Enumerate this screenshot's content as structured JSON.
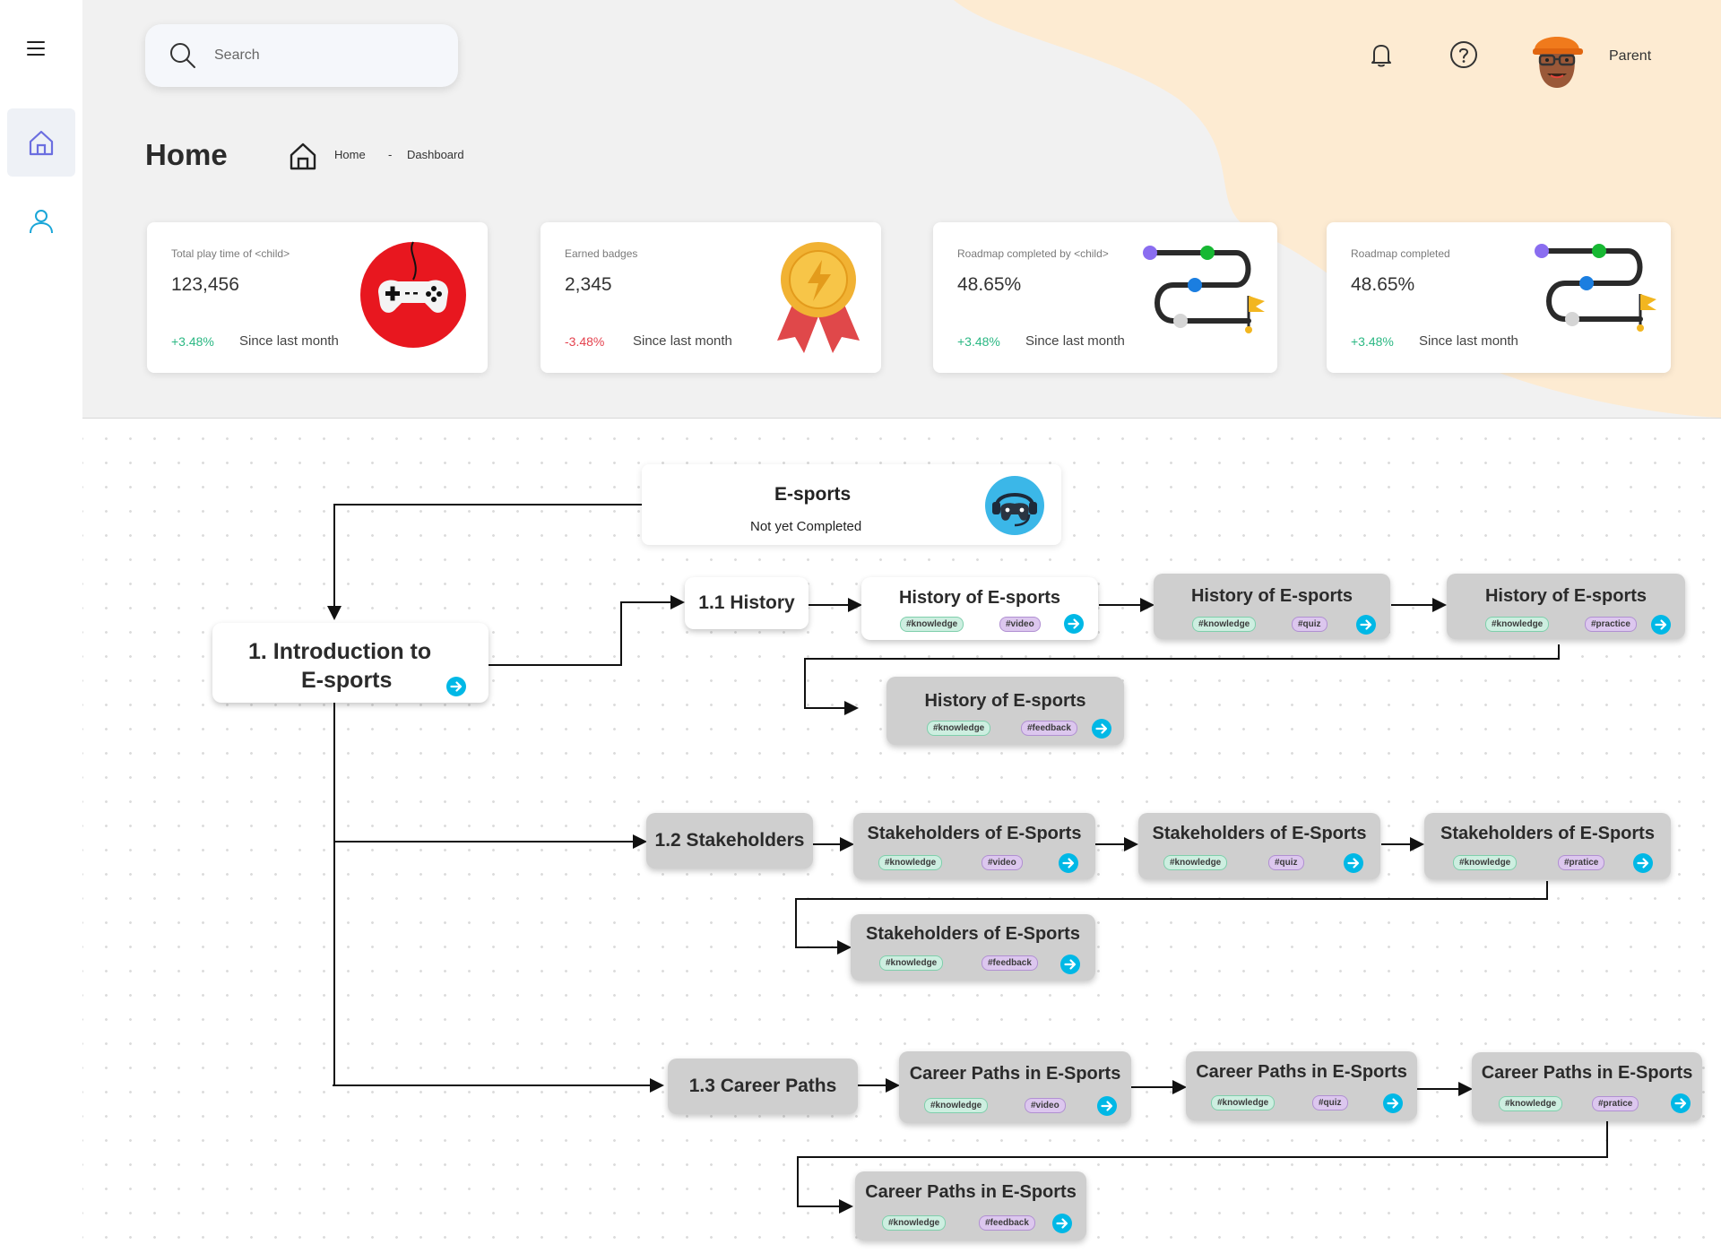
{
  "header": {
    "search_placeholder": "Search",
    "user_name": "Parent",
    "page_title": "Home",
    "breadcrumb": [
      "Home",
      "-",
      "Dashboard"
    ]
  },
  "cards": [
    {
      "label": "Total play time of <child>",
      "value": "123,456",
      "change": "+3.48%",
      "since": "Since last month",
      "trend": "up",
      "icon": "gamepad-icon"
    },
    {
      "label": "Earned badges",
      "value": "2,345",
      "change": "-3.48%",
      "since": "Since last month",
      "trend": "down",
      "icon": "badge-icon"
    },
    {
      "label": "Roadmap completed by <child>",
      "value": "48.65%",
      "change": "+3.48%",
      "since": "Since last month",
      "trend": "up",
      "icon": "roadmap-icon"
    },
    {
      "label": "Roadmap completed",
      "value": "48.65%",
      "change": "+3.48%",
      "since": "Since last month",
      "trend": "up",
      "icon": "roadmap-icon"
    }
  ],
  "roadmap": {
    "root": {
      "title": "E-sports",
      "status": "Not yet Completed"
    },
    "module": {
      "line1": "1. Introduction to",
      "line2": "E-sports"
    },
    "sections": [
      {
        "title": "1.1 History",
        "lessons": [
          {
            "title": "History of E-sports",
            "tags": [
              "#knowledge",
              "#video"
            ]
          },
          {
            "title": "History of E-sports",
            "tags": [
              "#knowledge",
              "#quiz"
            ]
          },
          {
            "title": "History of E-sports",
            "tags": [
              "#knowledge",
              "#practice"
            ]
          },
          {
            "title": "History of E-sports",
            "tags": [
              "#knowledge",
              "#feedback"
            ]
          }
        ]
      },
      {
        "title": "1.2 Stakeholders",
        "lessons": [
          {
            "title": "Stakeholders of E-Sports",
            "tags": [
              "#knowledge",
              "#video"
            ]
          },
          {
            "title": "Stakeholders of E-Sports",
            "tags": [
              "#knowledge",
              "#quiz"
            ]
          },
          {
            "title": "Stakeholders of E-Sports",
            "tags": [
              "#knowledge",
              "#pratice"
            ]
          },
          {
            "title": "Stakeholders of E-Sports",
            "tags": [
              "#knowledge",
              "#feedback"
            ]
          }
        ]
      },
      {
        "title": "1.3 Career Paths",
        "lessons": [
          {
            "title": "Career Paths in E-Sports",
            "tags": [
              "#knowledge",
              "#video"
            ]
          },
          {
            "title": "Career Paths in E-Sports",
            "tags": [
              "#knowledge",
              "#quiz"
            ]
          },
          {
            "title": "Career Paths in E-Sports",
            "tags": [
              "#knowledge",
              "#pratice"
            ]
          },
          {
            "title": "Career Paths in E-Sports",
            "tags": [
              "#knowledge",
              "#feedback"
            ]
          }
        ]
      }
    ]
  },
  "colors": {
    "accent": "#00b8e6",
    "up": "#2cb884",
    "down": "#e4434f",
    "tag_knowledge": "#cdeee0",
    "tag_activity": "#dcc7ee"
  }
}
